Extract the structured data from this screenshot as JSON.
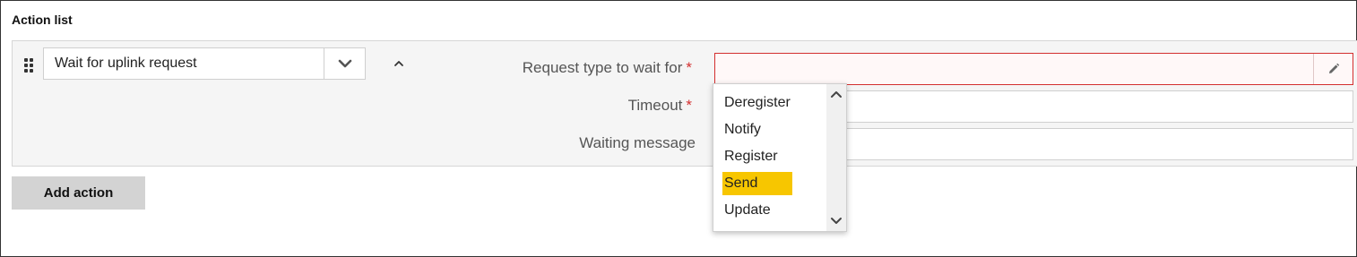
{
  "section": {
    "title": "Action list"
  },
  "action": {
    "selected_type": "Wait for uplink request"
  },
  "fields": {
    "request_type": {
      "label": "Request type to wait for",
      "required_mark": "*",
      "value": ""
    },
    "timeout": {
      "label": "Timeout",
      "required_mark": "*",
      "value": ""
    },
    "waiting_message": {
      "label": "Waiting message",
      "value": ""
    }
  },
  "dropdown": {
    "options": [
      "Deregister",
      "Notify",
      "Register",
      "Send",
      "Update"
    ],
    "highlighted": "Send"
  },
  "buttons": {
    "add_action": "Add action"
  },
  "colors": {
    "error_border": "#d32f2f",
    "highlight": "#f7c600",
    "panel_bg": "#f5f5f5",
    "button_bg": "#d3d3d3"
  },
  "icons": {
    "drag": "drag-handle-icon",
    "select_caret": "chevron-down-icon",
    "collapse": "chevron-up-icon",
    "edit": "pencil-icon",
    "scroll_up": "chevron-up-icon",
    "scroll_down": "chevron-down-icon"
  }
}
